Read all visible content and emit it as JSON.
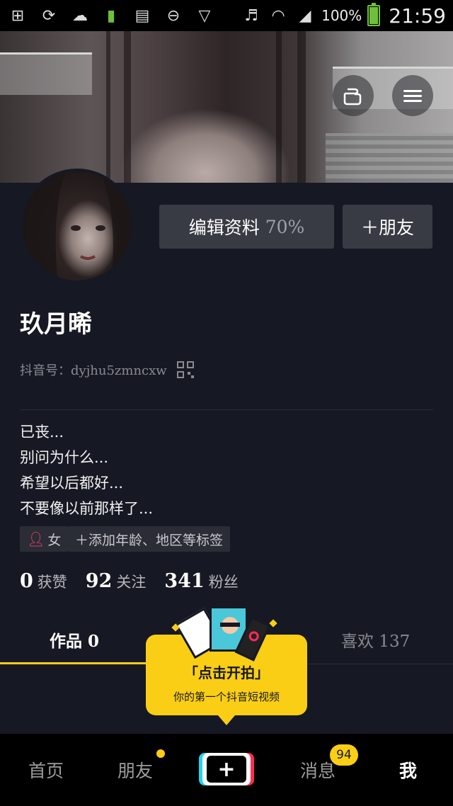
{
  "status_bar": {
    "battery_text": "100%",
    "time": "21:59",
    "icons": [
      "add-box-icon",
      "sync-icon",
      "cloud-icon",
      "battery-small-icon",
      "sim-icon",
      "do-not-disturb-icon",
      "shield-icon",
      "mute-icon",
      "wifi-icon",
      "signal-icon",
      "battery-icon"
    ]
  },
  "profile": {
    "name": "玖月晞",
    "douyin_id": "抖音号：dyjhu5zmncxw",
    "edit_profile_label": "编辑资料",
    "edit_profile_percent": "70%",
    "add_friend_label": "＋朋友",
    "bio_lines": [
      "已丧...",
      "别问为什么...",
      "希望以后都好...",
      "不要像以前那样了..."
    ],
    "gender_label": "女",
    "add_tags_label": "＋添加年龄、地区等标签"
  },
  "stats": {
    "likes_count": "0",
    "likes_label": "获赞",
    "following_count": "92",
    "following_label": "关注",
    "followers_count": "341",
    "followers_label": "粉丝"
  },
  "tabs": {
    "works": "作品 0",
    "likes": "喜欢 137"
  },
  "bubble": {
    "line1": "「点击开拍」",
    "line2": "你的第一个抖音短视频"
  },
  "bottom_nav": {
    "home": "首页",
    "friends": "朋友",
    "create": "+",
    "messages": "消息",
    "messages_badge": "94",
    "me": "我"
  },
  "colors": {
    "background": "#161823",
    "accent_yellow": "#face15",
    "button_gray": "#393b44",
    "female_pink": "#f23f6a"
  }
}
